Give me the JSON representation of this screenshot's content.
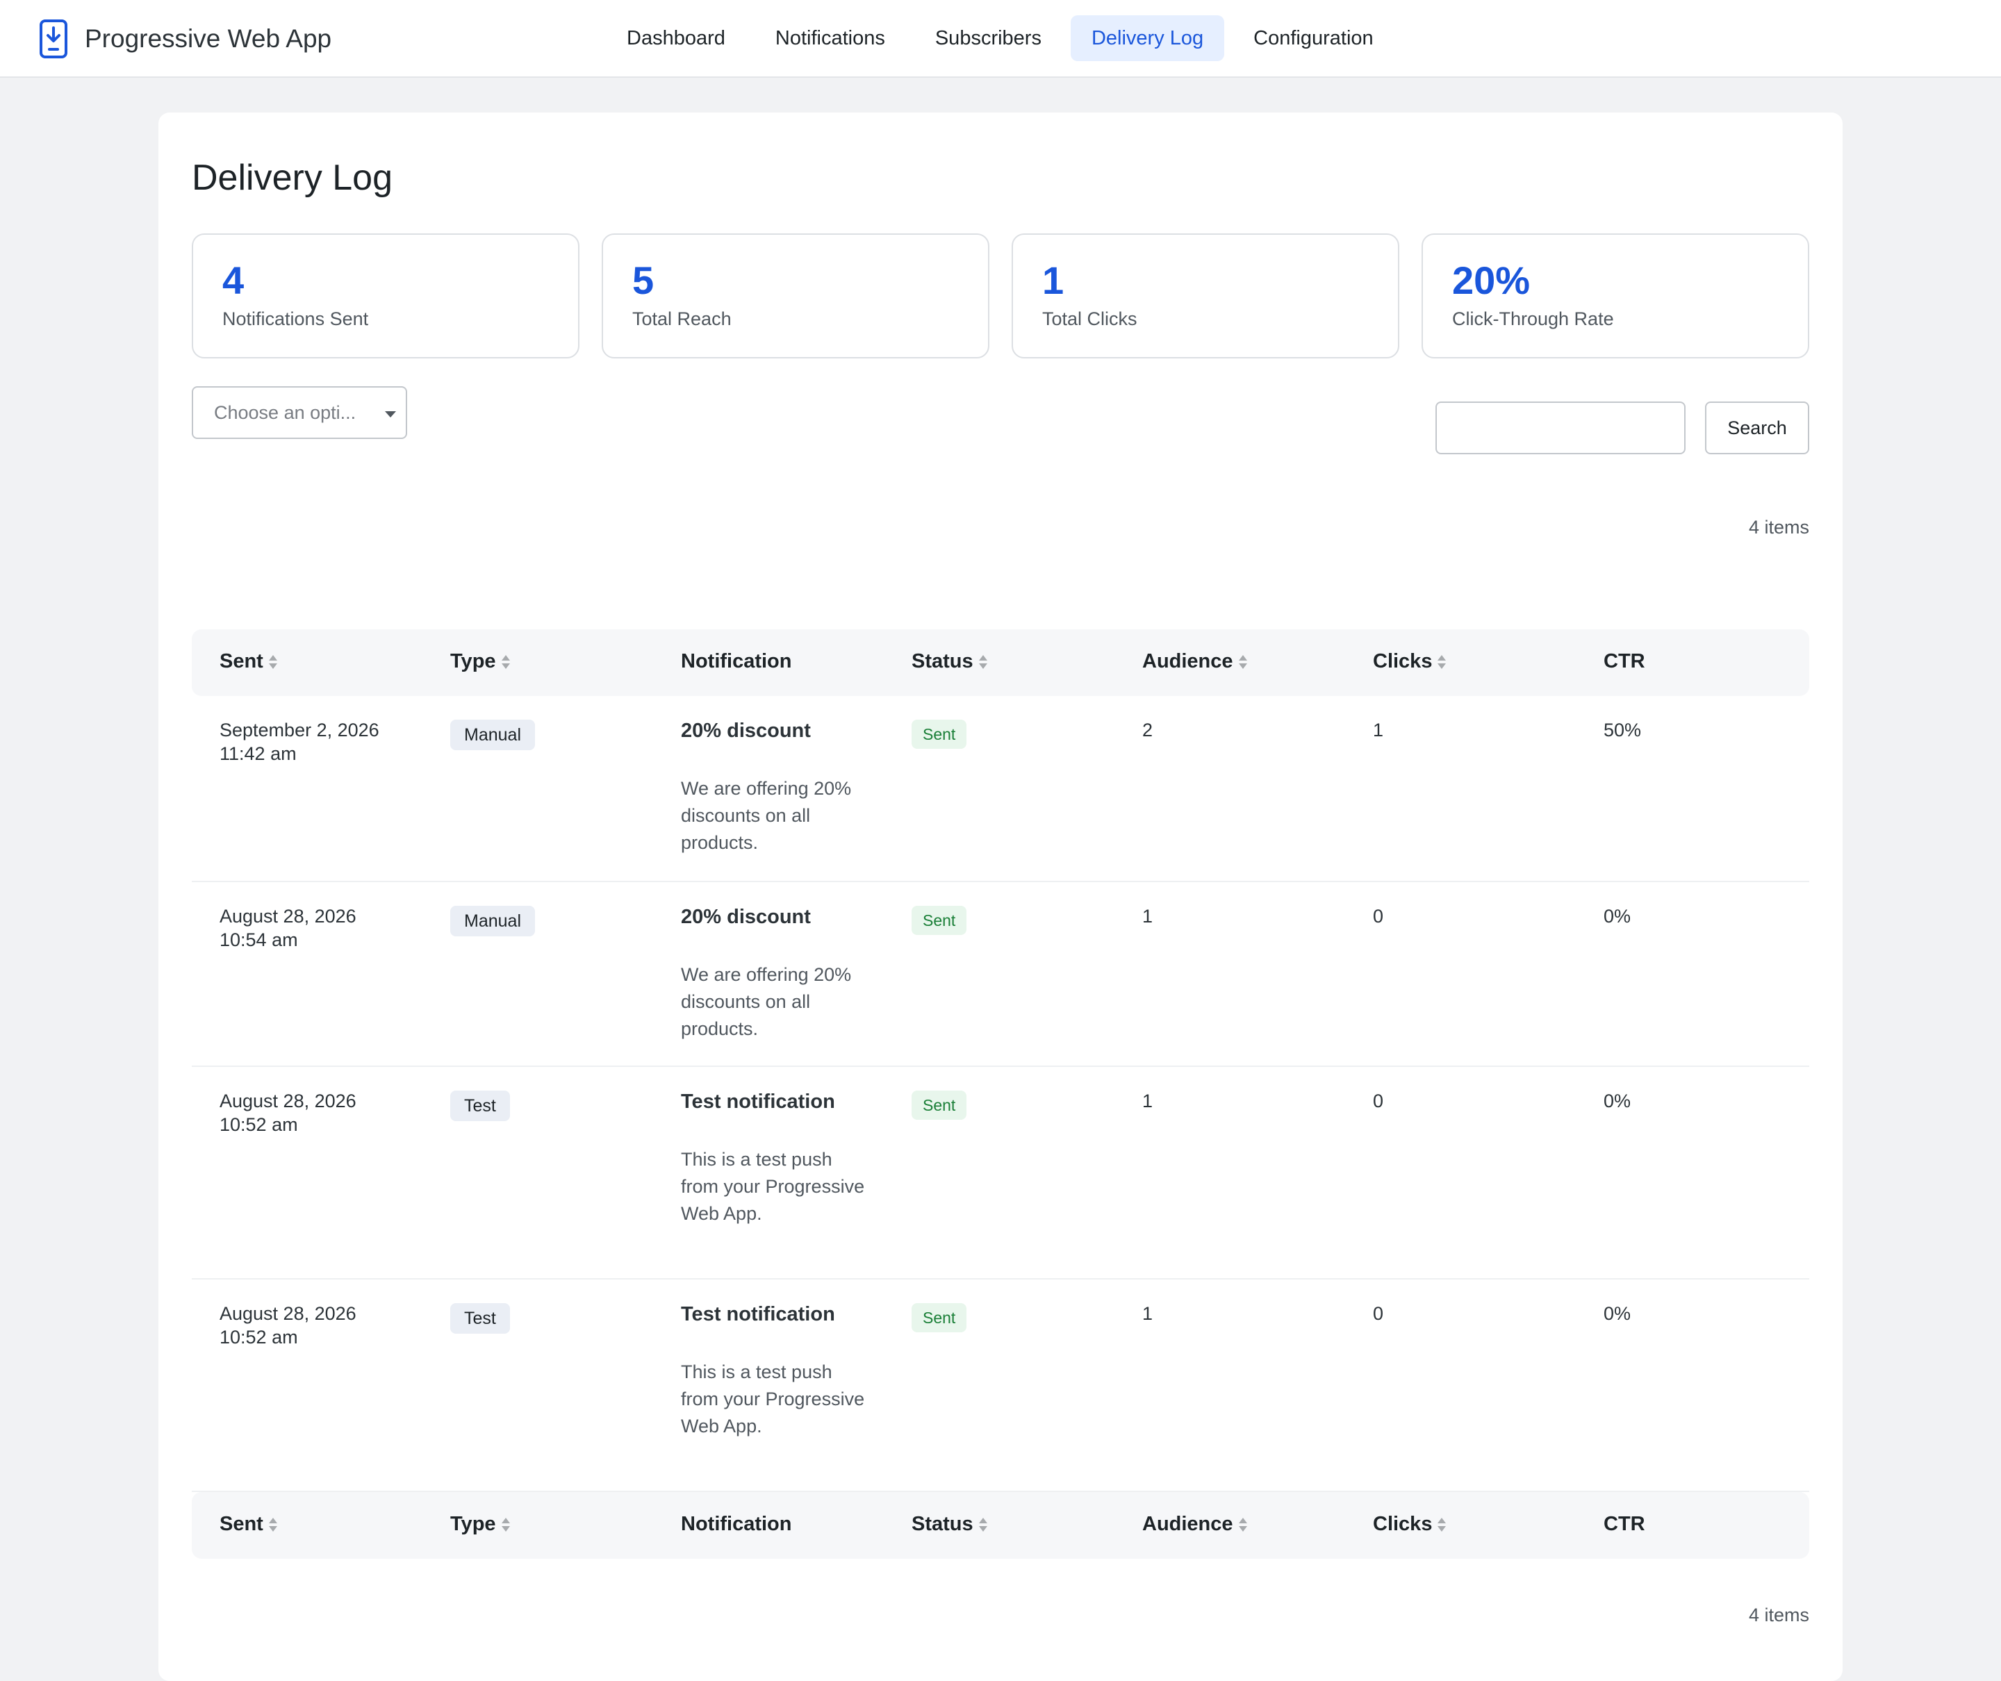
{
  "app": {
    "title": "Progressive Web App",
    "brand_icon": "phone-download-icon",
    "accent_color": "#1a56db"
  },
  "nav": {
    "items": [
      {
        "label": "Dashboard"
      },
      {
        "label": "Notifications"
      },
      {
        "label": "Subscribers"
      },
      {
        "label": "Delivery Log",
        "active": true
      },
      {
        "label": "Configuration"
      }
    ]
  },
  "page": {
    "title": "Delivery Log"
  },
  "stats": [
    {
      "value": "4",
      "label": "Notifications Sent"
    },
    {
      "value": "5",
      "label": "Total Reach"
    },
    {
      "value": "1",
      "label": "Total Clicks"
    },
    {
      "value": "20%",
      "label": "Click-Through Rate"
    }
  ],
  "filter": {
    "placeholder": "Choose an opti..."
  },
  "search": {
    "value": "",
    "button_label": "Search"
  },
  "items_count": "4 items",
  "table": {
    "columns": [
      {
        "label": "Sent",
        "sortable": true
      },
      {
        "label": "Type",
        "sortable": true
      },
      {
        "label": "Notification",
        "sortable": false
      },
      {
        "label": "Status",
        "sortable": true
      },
      {
        "label": "Audience",
        "sortable": true
      },
      {
        "label": "Clicks",
        "sortable": true
      },
      {
        "label": "CTR",
        "sortable": false
      }
    ],
    "rows": [
      {
        "sent_date": "September 2, 2026",
        "sent_time": "11:42 am",
        "type": "Manual",
        "title": "20% discount",
        "body": "We are offering 20% discounts on all products.",
        "status": "Sent",
        "audience": "2",
        "clicks": "1",
        "ctr": "50%"
      },
      {
        "sent_date": "August 28, 2026",
        "sent_time": "10:54 am",
        "type": "Manual",
        "title": "20% discount",
        "body": "We are offering 20% discounts on all products.",
        "status": "Sent",
        "audience": "1",
        "clicks": "0",
        "ctr": "0%"
      },
      {
        "sent_date": "August 28, 2026",
        "sent_time": "10:52 am",
        "type": "Test",
        "title": "Test notification",
        "body": "This is a test push from your Progressive Web App.",
        "status": "Sent",
        "audience": "1",
        "clicks": "0",
        "ctr": "0%"
      },
      {
        "sent_date": "August 28, 2026",
        "sent_time": "10:52 am",
        "type": "Test",
        "title": "Test notification",
        "body": "This is a test push from your Progressive Web App.",
        "status": "Sent",
        "audience": "1",
        "clicks": "0",
        "ctr": "0%"
      }
    ]
  }
}
